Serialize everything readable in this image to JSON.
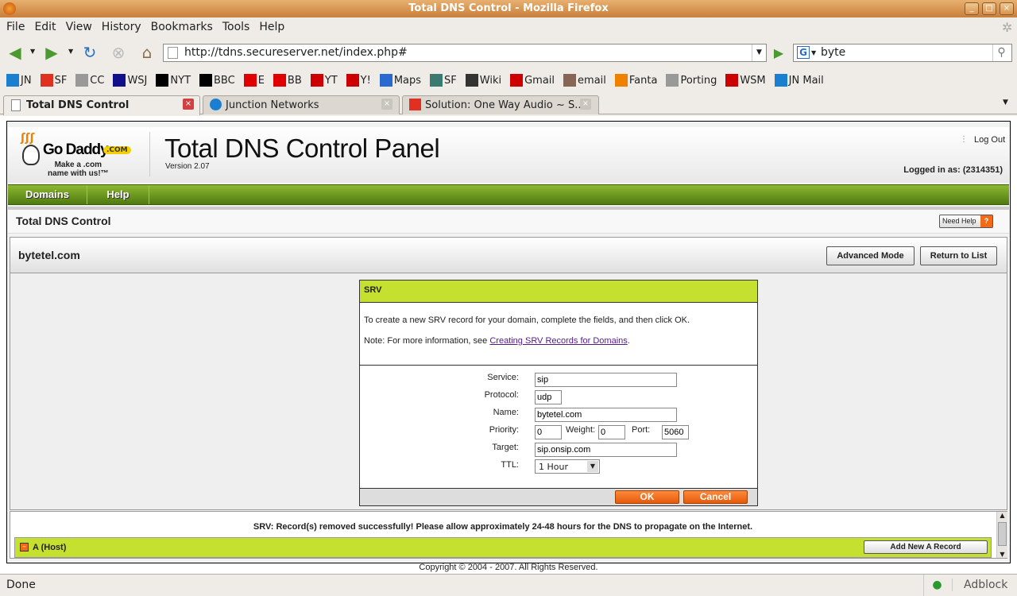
{
  "window": {
    "title": "Total DNS Control - Mozilla Firefox"
  },
  "menu": [
    "File",
    "Edit",
    "View",
    "History",
    "Bookmarks",
    "Tools",
    "Help"
  ],
  "navigation": {
    "url": "http://tdns.secureserver.net/index.php#",
    "search_value": "byte",
    "search_engine_icon": "google-icon"
  },
  "bookmarks": [
    {
      "label": "JN",
      "color": "#1a7fd0"
    },
    {
      "label": "SF",
      "color": "#e03020"
    },
    {
      "label": "CC",
      "color": "#999"
    },
    {
      "label": "WSJ",
      "color": "#10108a"
    },
    {
      "label": "NYT",
      "color": "#000"
    },
    {
      "label": "BBC",
      "color": "#000"
    },
    {
      "label": "E",
      "color": "#e00000"
    },
    {
      "label": "BB",
      "color": "#e00000"
    },
    {
      "label": "YT",
      "color": "#c00"
    },
    {
      "label": "Y!",
      "color": "#c00"
    },
    {
      "label": "Maps",
      "color": "#2a6ad0"
    },
    {
      "label": "SF",
      "color": "#3a7a70"
    },
    {
      "label": "Wiki",
      "color": "#333"
    },
    {
      "label": "Gmail",
      "color": "#c00"
    },
    {
      "label": "email",
      "color": "#865"
    },
    {
      "label": "Fanta",
      "color": "#f08000"
    },
    {
      "label": "Porting",
      "color": "#999"
    },
    {
      "label": "WSM",
      "color": "#c00"
    },
    {
      "label": "JN Mail",
      "color": "#1a7fd0"
    }
  ],
  "tabs": [
    {
      "label": "Total DNS Control",
      "active": true
    },
    {
      "label": "Junction Networks",
      "active": false
    },
    {
      "label": "Solution: One Way Audio ~ S...",
      "active": false
    }
  ],
  "page": {
    "logo_text": "Go Daddy .COM Make a .com name with us!",
    "logo_brand": "Go Daddy",
    "logo_com": ".COM",
    "logo_tagline1": "Make a .com",
    "logo_tagline2": "name with us!™",
    "title": "Total DNS Control Panel",
    "version": "Version 2.07",
    "logout": "Log Out",
    "logged_in": "Logged in as: (2314351)",
    "nav": [
      "Domains",
      "Help"
    ],
    "section_title": "Total DNS Control",
    "need_help": "Need Help",
    "domain": "bytetel.com",
    "advanced_mode": "Advanced Mode",
    "return_to_list": "Return to List",
    "dialog": {
      "header": "SRV",
      "intro": "To create a new SRV record for your domain, complete the fields, and then click OK.",
      "note_prefix": "Note: For more information, see ",
      "note_link": "Creating SRV Records for Domains",
      "note_suffix": ".",
      "labels": {
        "service": "Service:",
        "protocol": "Protocol:",
        "name": "Name:",
        "priority": "Priority:",
        "weight": "Weight:",
        "port": "Port:",
        "target": "Target:",
        "ttl": "TTL:"
      },
      "values": {
        "service": "sip",
        "protocol": "udp",
        "name": "bytetel.com",
        "priority": "0",
        "weight": "0",
        "port": "5060",
        "target": "sip.onsip.com",
        "ttl": "1 Hour"
      },
      "ok": "OK",
      "cancel": "Cancel"
    },
    "message": "SRV: Record(s) removed successfully! Please allow approximately 24-48 hours for the DNS to propagate on the Internet.",
    "record_section": "A (Host)",
    "add_record": "Add New A Record",
    "copyright": "Copyright © 2004 - 2007. All Rights Reserved."
  },
  "status": {
    "text": "Done",
    "adblock": "Adblock"
  },
  "colors": {
    "accent_green": "#c5e02e",
    "nav_green": "#5f8a18",
    "button_orange": "#f06a1a"
  }
}
